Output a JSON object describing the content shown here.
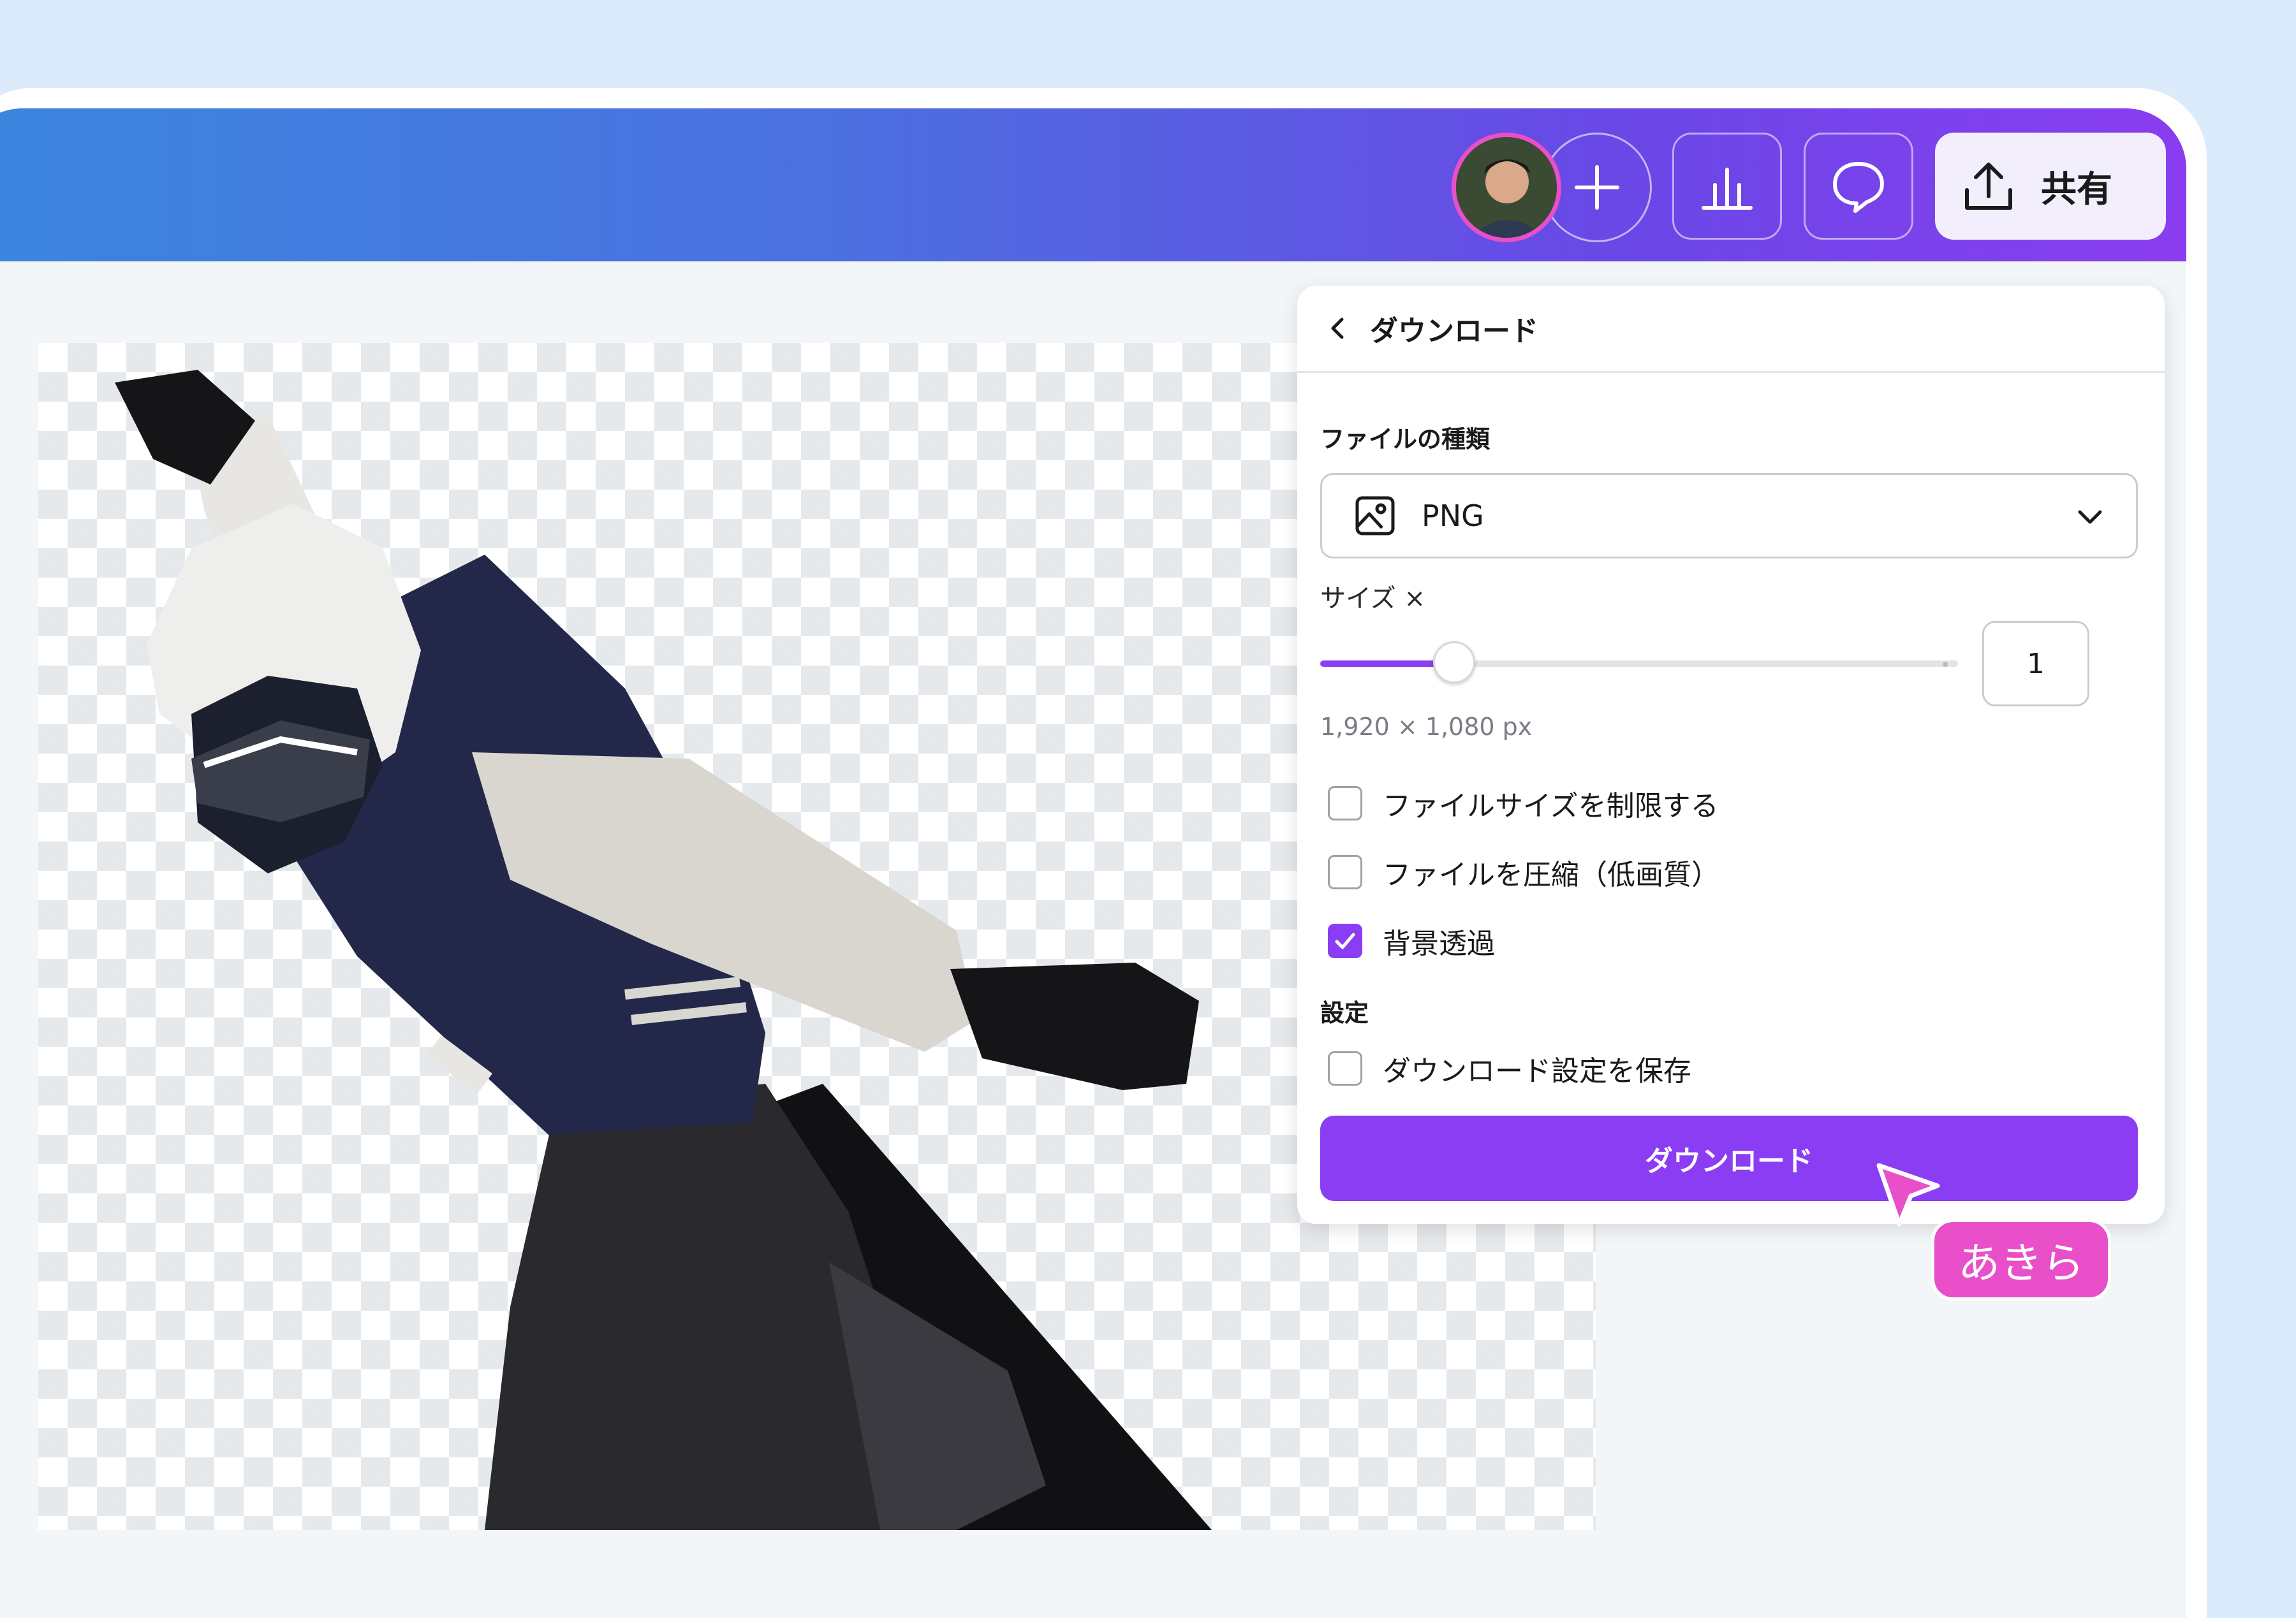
{
  "topbar": {
    "collaborator_avatar": "user-avatar",
    "add_icon": "plus-icon",
    "insights_icon": "bar-chart-icon",
    "comment_icon": "speech-bubble-icon",
    "share_icon": "upload-icon",
    "share_label": "共有"
  },
  "panel": {
    "back_icon": "chevron-left-icon",
    "title": "ダウンロード",
    "file_type_label": "ファイルの種類",
    "file_type_value": "PNG",
    "file_type_icon": "image-icon",
    "size_label": "サイズ ×",
    "size_scale_fraction": 0.21,
    "size_value": "1",
    "dimensions_text": "1,920 × 1,080 px",
    "options": [
      {
        "label": "ファイルサイズを制限する",
        "checked": false
      },
      {
        "label": "ファイルを圧縮（低画質）",
        "checked": false
      },
      {
        "label": "背景透過",
        "checked": true
      }
    ],
    "settings_label": "設定",
    "save_settings": {
      "label": "ダウンロード設定を保存",
      "checked": false
    },
    "download_button": "ダウンロード"
  },
  "cursor": {
    "name": "あきら",
    "color": "#e84fc8"
  },
  "colors": {
    "accent": "#8b3df4",
    "topbar_gradient_start": "#3b86de",
    "topbar_gradient_end": "#8a3df0"
  }
}
